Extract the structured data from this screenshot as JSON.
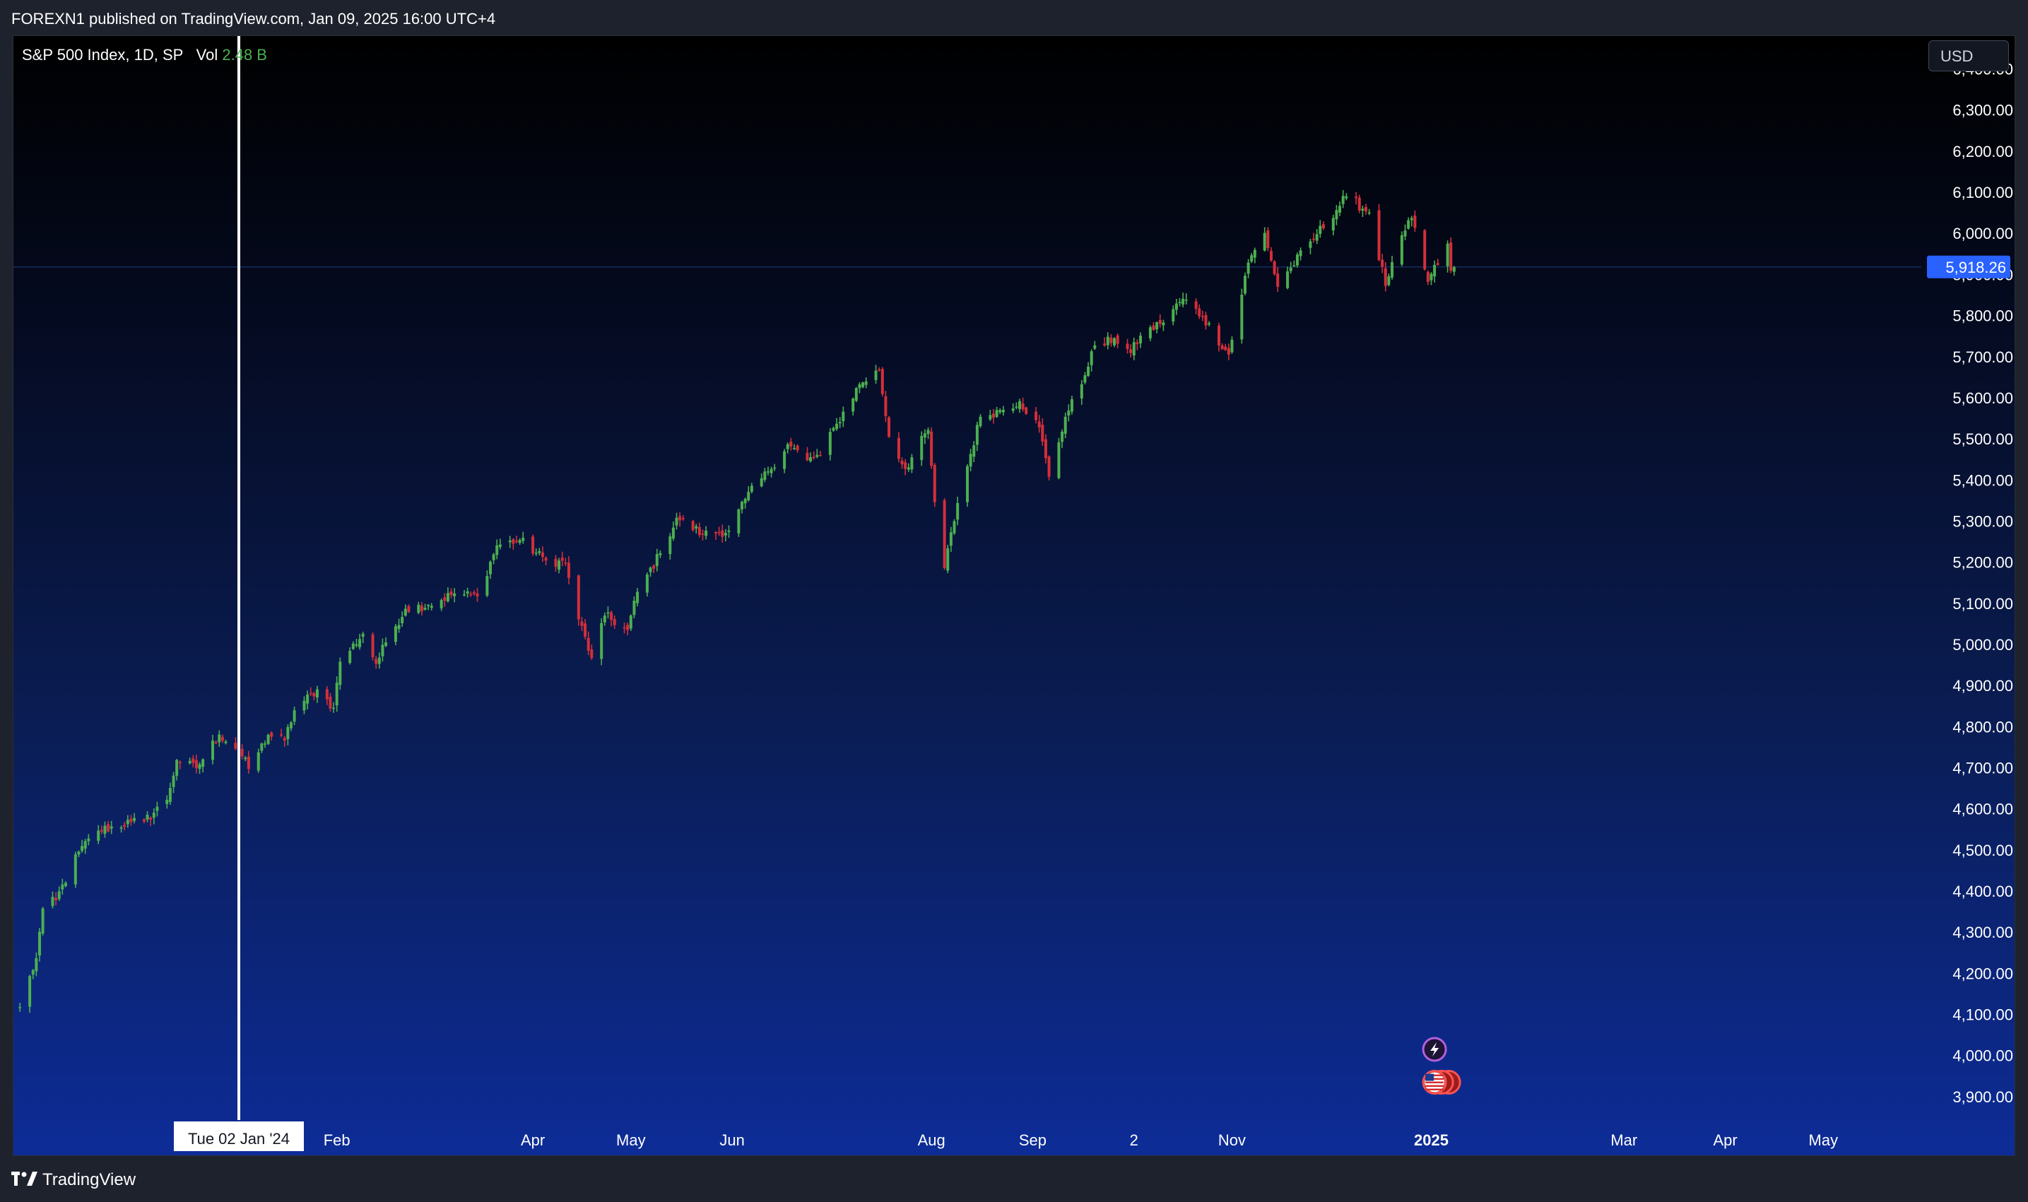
{
  "header": {
    "publish_text": "FOREXN1 published on TradingView.com, Jan 09, 2025 16:00 UTC+4"
  },
  "legend": {
    "symbol": "S&P 500 Index, 1D, SP",
    "vol_label": "Vol",
    "vol_value": "2.48 B"
  },
  "currency": "USD",
  "price_tag": {
    "value": 5918.26,
    "label": "5,918.26",
    "color": "#2962ff"
  },
  "crosshair": {
    "date_label": "Tue 02 Jan '24"
  },
  "footer": {
    "brand": "TradingView"
  },
  "colors": {
    "up": "#4caf50",
    "down": "#d32f3a",
    "text": "#ffffff"
  },
  "chart_data": {
    "type": "candlestick",
    "y_axis": {
      "min": 3850,
      "max": 6480,
      "ticks": [
        3900,
        4000,
        4100,
        4200,
        4300,
        4400,
        4500,
        4600,
        4700,
        4800,
        4900,
        5000,
        5100,
        5200,
        5300,
        5400,
        5500,
        5600,
        5700,
        5800,
        5900,
        6000,
        6100,
        6200,
        6300,
        6400
      ],
      "tick_labels": [
        "3,900.00",
        "4,000.00",
        "4,100.00",
        "4,200.00",
        "4,300.00",
        "4,400.00",
        "4,500.00",
        "4,600.00",
        "4,700.00",
        "4,800.00",
        "4,900.00",
        "5,000.00",
        "5,100.00",
        "5,200.00",
        "5,300.00",
        "5,400.00",
        "5,500.00",
        "5,600.00",
        "5,700.00",
        "5,800.00",
        "5,900.00",
        "6,000.00",
        "6,100.00",
        "6,200.00",
        "6,300.00",
        "6,400.00"
      ]
    },
    "x_axis": {
      "min": "2023-10-25",
      "max": "2025-05-31",
      "ticks": [
        {
          "date": "2024-02-01",
          "label": "Feb"
        },
        {
          "date": "2024-04-01",
          "label": "Apr"
        },
        {
          "date": "2024-05-01",
          "label": "May"
        },
        {
          "date": "2024-06-01",
          "label": "Jun"
        },
        {
          "date": "2024-08-01",
          "label": "Aug"
        },
        {
          "date": "2024-09-01",
          "label": "Sep"
        },
        {
          "date": "2024-10-02",
          "label": "2"
        },
        {
          "date": "2024-11-01",
          "label": "Nov"
        },
        {
          "date": "2025-01-01",
          "label": "2025"
        },
        {
          "date": "2025-03-01",
          "label": "Mar"
        },
        {
          "date": "2025-04-01",
          "label": "Apr"
        },
        {
          "date": "2025-05-01",
          "label": "May"
        }
      ]
    },
    "crosshair_date": "2024-01-02",
    "close_anchors": [
      [
        "2023-10-27",
        4118
      ],
      [
        "2023-11-01",
        4237
      ],
      [
        "2023-11-03",
        4358
      ],
      [
        "2023-11-07",
        4378
      ],
      [
        "2023-11-14",
        4496
      ],
      [
        "2023-11-20",
        4547
      ],
      [
        "2023-11-30",
        4568
      ],
      [
        "2023-12-04",
        4569
      ],
      [
        "2023-12-11",
        4622
      ],
      [
        "2023-12-14",
        4719
      ],
      [
        "2023-12-20",
        4699
      ],
      [
        "2023-12-27",
        4781
      ],
      [
        "2024-01-02",
        4743
      ],
      [
        "2024-01-05",
        4697
      ],
      [
        "2024-01-11",
        4780
      ],
      [
        "2024-01-16",
        4766
      ],
      [
        "2024-01-19",
        4840
      ],
      [
        "2024-01-26",
        4891
      ],
      [
        "2024-01-31",
        4846
      ],
      [
        "2024-02-02",
        4958
      ],
      [
        "2024-02-09",
        5026
      ],
      [
        "2024-02-13",
        4953
      ],
      [
        "2024-02-16",
        5005
      ],
      [
        "2024-02-22",
        5087
      ],
      [
        "2024-02-29",
        5096
      ],
      [
        "2024-03-08",
        5124
      ],
      [
        "2024-03-15",
        5117
      ],
      [
        "2024-03-21",
        5241
      ],
      [
        "2024-03-28",
        5254
      ],
      [
        "2024-04-05",
        5204
      ],
      [
        "2024-04-11",
        5199
      ],
      [
        "2024-04-15",
        5061
      ],
      [
        "2024-04-19",
        4967
      ],
      [
        "2024-04-23",
        5070
      ],
      [
        "2024-04-30",
        5035
      ],
      [
        "2024-05-03",
        5128
      ],
      [
        "2024-05-10",
        5222
      ],
      [
        "2024-05-15",
        5308
      ],
      [
        "2024-05-23",
        5268
      ],
      [
        "2024-05-31",
        5277
      ],
      [
        "2024-06-05",
        5354
      ],
      [
        "2024-06-12",
        5421
      ],
      [
        "2024-06-18",
        5487
      ],
      [
        "2024-06-24",
        5448
      ],
      [
        "2024-06-28",
        5460
      ],
      [
        "2024-07-03",
        5537
      ],
      [
        "2024-07-10",
        5633
      ],
      [
        "2024-07-16",
        5667
      ],
      [
        "2024-07-19",
        5505
      ],
      [
        "2024-07-24",
        5427
      ],
      [
        "2024-07-31",
        5522
      ],
      [
        "2024-08-02",
        5346
      ],
      [
        "2024-08-05",
        5186
      ],
      [
        "2024-08-09",
        5344
      ],
      [
        "2024-08-16",
        5554
      ],
      [
        "2024-08-22",
        5570
      ],
      [
        "2024-08-28",
        5592
      ],
      [
        "2024-09-03",
        5528
      ],
      [
        "2024-09-06",
        5408
      ],
      [
        "2024-09-11",
        5554
      ],
      [
        "2024-09-16",
        5633
      ],
      [
        "2024-09-19",
        5713
      ],
      [
        "2024-09-26",
        5745
      ],
      [
        "2024-10-01",
        5709
      ],
      [
        "2024-10-04",
        5751
      ],
      [
        "2024-10-10",
        5780
      ],
      [
        "2024-10-17",
        5841
      ],
      [
        "2024-10-23",
        5797
      ],
      [
        "2024-10-31",
        5705
      ],
      [
        "2024-11-06",
        5929
      ],
      [
        "2024-11-11",
        6001
      ],
      [
        "2024-11-15",
        5870
      ],
      [
        "2024-11-19",
        5917
      ],
      [
        "2024-11-27",
        5998
      ],
      [
        "2024-12-06",
        6090
      ],
      [
        "2024-12-13",
        6051
      ],
      [
        "2024-12-18",
        5872
      ],
      [
        "2024-12-20",
        5930
      ],
      [
        "2024-12-26",
        6037
      ],
      [
        "2024-12-31",
        5882
      ],
      [
        "2025-01-06",
        5975
      ],
      [
        "2025-01-07",
        5909
      ],
      [
        "2025-01-08",
        5918
      ]
    ],
    "events": [
      {
        "type": "lightning",
        "date": "2025-01-02",
        "price": 4015
      },
      {
        "type": "us-flag",
        "date": "2025-01-02",
        "price": 3935
      }
    ]
  }
}
